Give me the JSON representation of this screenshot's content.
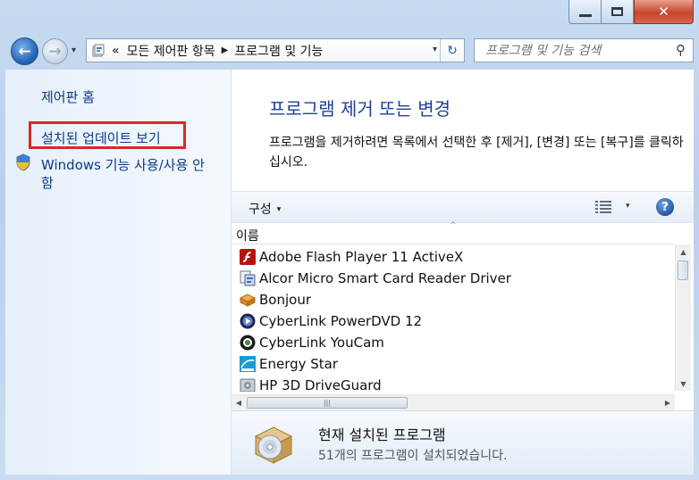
{
  "window": {
    "minimize_icon": "minimize-icon",
    "maximize_icon": "maximize-icon",
    "close_icon": "close-icon",
    "close_glyph": "✕"
  },
  "nav": {
    "back_icon": "back-arrow-icon",
    "forward_icon": "forward-arrow-icon",
    "back_glyph": "←",
    "forward_glyph": "→",
    "history_glyph": "▾"
  },
  "address": {
    "overflow": "«",
    "breadcrumb": [
      "모든 제어판 항목",
      "프로그램 및 기능"
    ],
    "separator_glyph": "▶",
    "dropdown_glyph": "▾",
    "refresh_glyph": "↻"
  },
  "search": {
    "placeholder": "프로그램 및 기능 검색",
    "icon_glyph": "⚲"
  },
  "sidebar": {
    "home": "제어판 홈",
    "view_updates": "설치된 업데이트 보기",
    "windows_features_line1": "Windows 기능 사용/사용 안",
    "windows_features_line2": "함"
  },
  "main": {
    "title": "프로그램 제거 또는 변경",
    "description": "프로그램을 제거하려면 목록에서 선택한 후 [제거], [변경] 또는 [복구]를 클릭하십시오."
  },
  "toolbar": {
    "organize": "구성",
    "organize_caret": "▾",
    "view_caret": "▾",
    "help_glyph": "?"
  },
  "list": {
    "column_name": "이름",
    "sort_glyph": "^",
    "programs": [
      {
        "name": "Adobe Flash Player 11 ActiveX",
        "icon": "flash-icon"
      },
      {
        "name": "Alcor Micro Smart Card Reader Driver",
        "icon": "installer-icon"
      },
      {
        "name": "Bonjour",
        "icon": "bonjour-icon"
      },
      {
        "name": "CyberLink PowerDVD 12",
        "icon": "powerdvd-icon"
      },
      {
        "name": "CyberLink YouCam",
        "icon": "youcam-icon"
      },
      {
        "name": "Energy Star",
        "icon": "energy-star-icon"
      },
      {
        "name": "HP 3D DriveGuard",
        "icon": "driveguard-icon"
      }
    ],
    "scroll_glyphs": {
      "up": "▲",
      "down": "▼",
      "left": "◀",
      "right": "▶",
      "grip": "|||"
    }
  },
  "details": {
    "title": "현재 설치된 프로그램",
    "subtitle": "51개의 프로그램이 설치되었습니다."
  },
  "colors": {
    "link": "#0c3a86",
    "title": "#1e3f95",
    "highlight": "#d42a2a"
  }
}
